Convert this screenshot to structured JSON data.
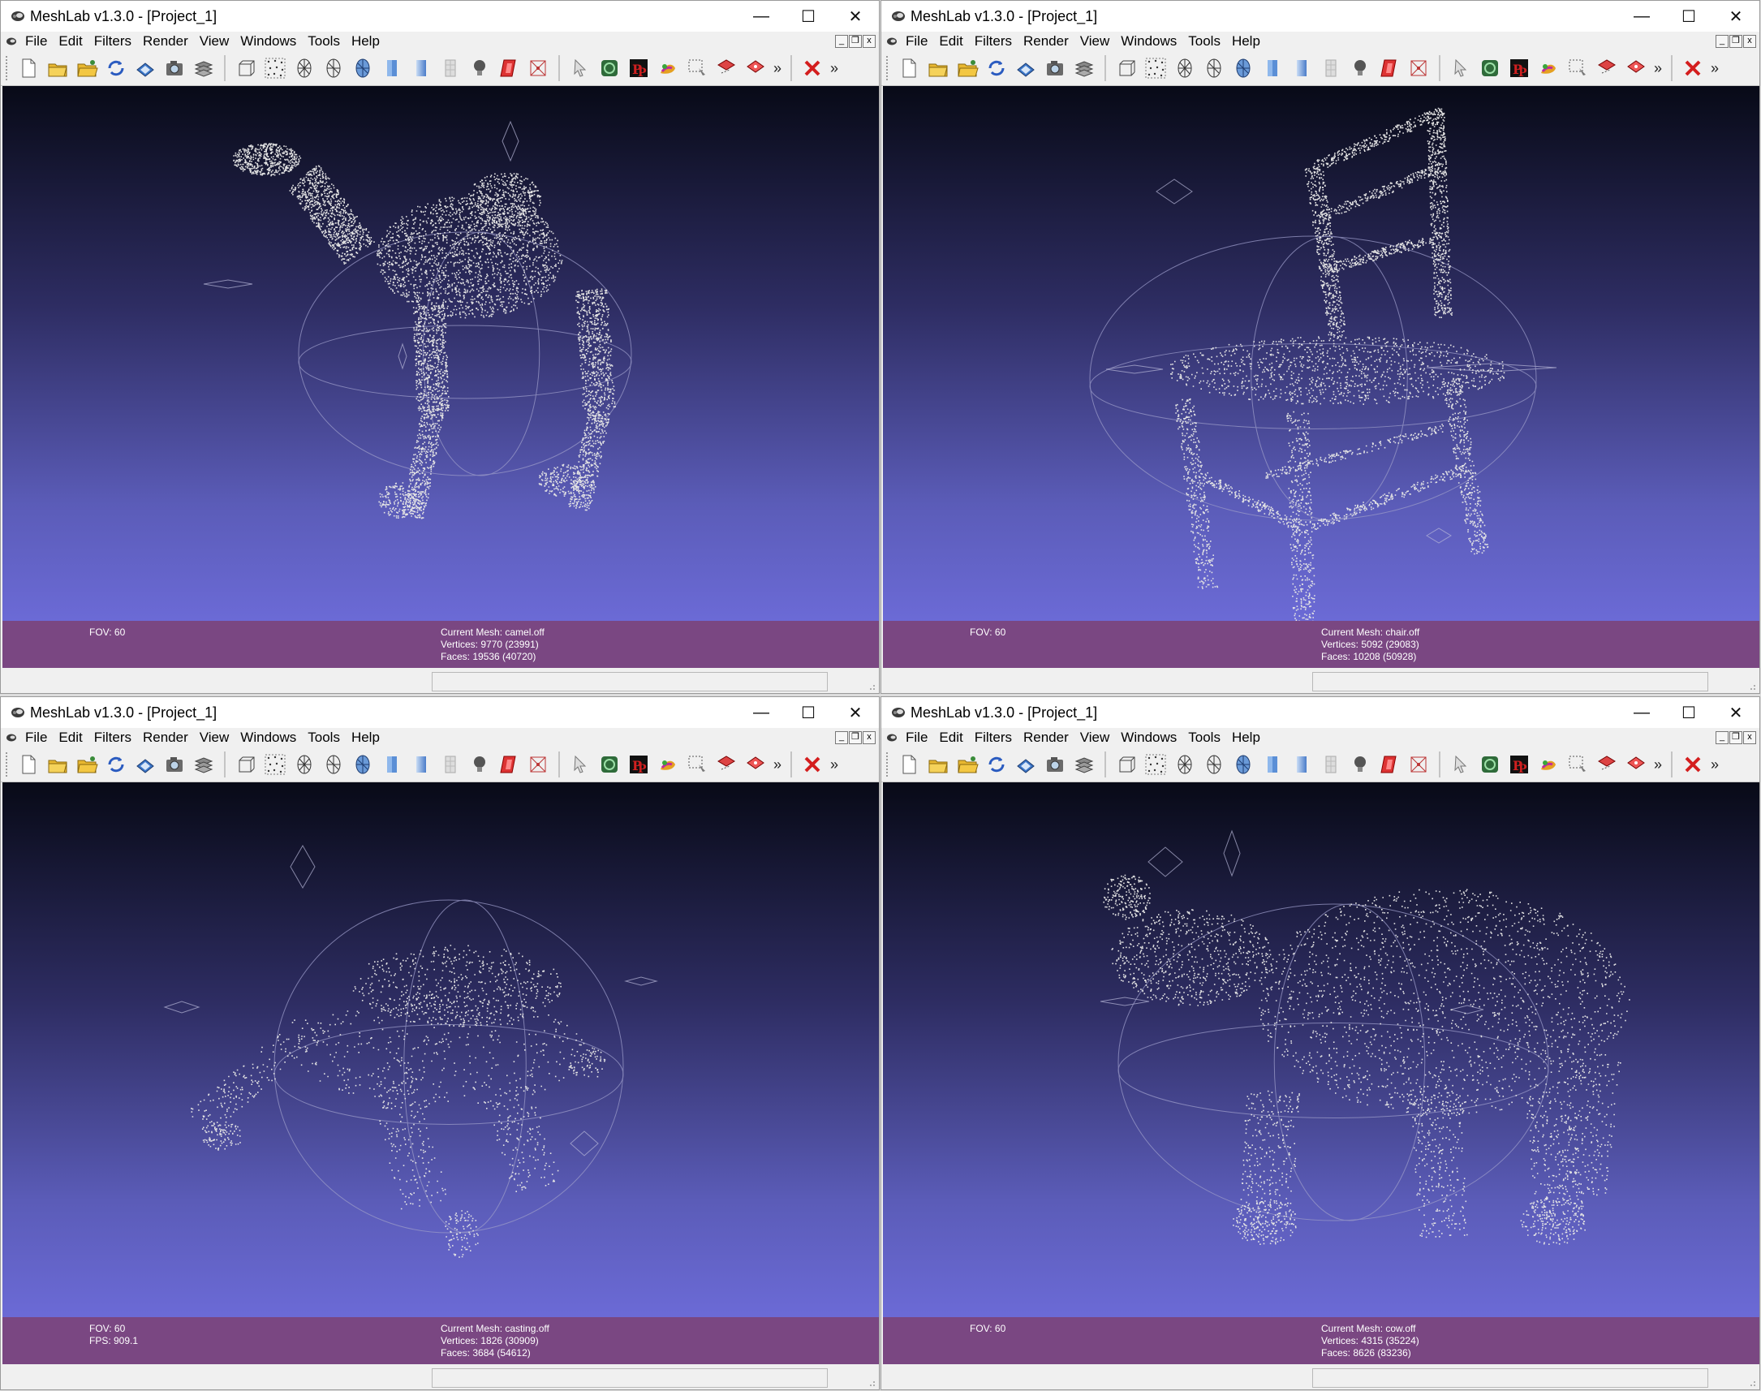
{
  "windows": [
    {
      "title": "MeshLab v1.3.0 - [Project_1]",
      "menu": [
        "File",
        "Edit",
        "Filters",
        "Render",
        "View",
        "Windows",
        "Tools",
        "Help"
      ],
      "info": {
        "fov": "FOV: 60",
        "fps": "",
        "mesh": "Current Mesh: camel.off",
        "vertices": "Vertices: 9770 (23991)",
        "faces": "Faces: 19536 (40720)"
      },
      "model": "camel"
    },
    {
      "title": "MeshLab v1.3.0 - [Project_1]",
      "menu": [
        "File",
        "Edit",
        "Filters",
        "Render",
        "View",
        "Windows",
        "Tools",
        "Help"
      ],
      "info": {
        "fov": "FOV: 60",
        "fps": "",
        "mesh": "Current Mesh: chair.off",
        "vertices": "Vertices: 5092 (29083)",
        "faces": "Faces: 10208 (50928)"
      },
      "model": "chair"
    },
    {
      "title": "MeshLab v1.3.0 - [Project_1]",
      "menu": [
        "File",
        "Edit",
        "Filters",
        "Render",
        "View",
        "Windows",
        "Tools",
        "Help"
      ],
      "info": {
        "fov": "FOV: 60",
        "fps": "FPS:   909.1",
        "mesh": "Current Mesh: casting.off",
        "vertices": "Vertices: 1826 (30909)",
        "faces": "Faces: 3684 (54612)"
      },
      "model": "casting"
    },
    {
      "title": "MeshLab v1.3.0 - [Project_1]",
      "menu": [
        "File",
        "Edit",
        "Filters",
        "Render",
        "View",
        "Windows",
        "Tools",
        "Help"
      ],
      "info": {
        "fov": "FOV: 60",
        "fps": "",
        "mesh": "Current Mesh: cow.off",
        "vertices": "Vertices: 4315 (35224)",
        "faces": "Faces: 8626 (83236)"
      },
      "model": "cow"
    }
  ],
  "window_controls": {
    "minimize": "—",
    "maximize": "☐",
    "close": "✕"
  },
  "mdi_controls": {
    "minimize": "_",
    "restore": "❐",
    "close": "x"
  },
  "toolbar_more": "»",
  "toolbar_icons": {
    "group1": [
      "new-document-icon",
      "open-folder-icon",
      "open-project-icon",
      "reload-icon",
      "save-as-icon",
      "snapshot-icon",
      "layers-icon"
    ],
    "group2": [
      "bounding-box-icon",
      "points-render-icon",
      "wireframe-icon",
      "hidden-lines-icon",
      "flat-lines-icon",
      "flat-shading-icon",
      "smooth-shading-icon",
      "texture-icon",
      "light-bulb-icon",
      "back-face-icon",
      "selected-faces-icon"
    ],
    "group3": [
      "pointer-icon",
      "measure-icon",
      "align-icon",
      "paint-icon",
      "select-region-icon",
      "select-faces-icon",
      "select-vertices-icon"
    ],
    "group4": [
      "close-mesh-icon"
    ]
  },
  "colors": {
    "gradient_top": "#080a17",
    "gradient_bottom": "#7270e2",
    "infobar": "#7a4782",
    "points": "#e4e4e4"
  }
}
